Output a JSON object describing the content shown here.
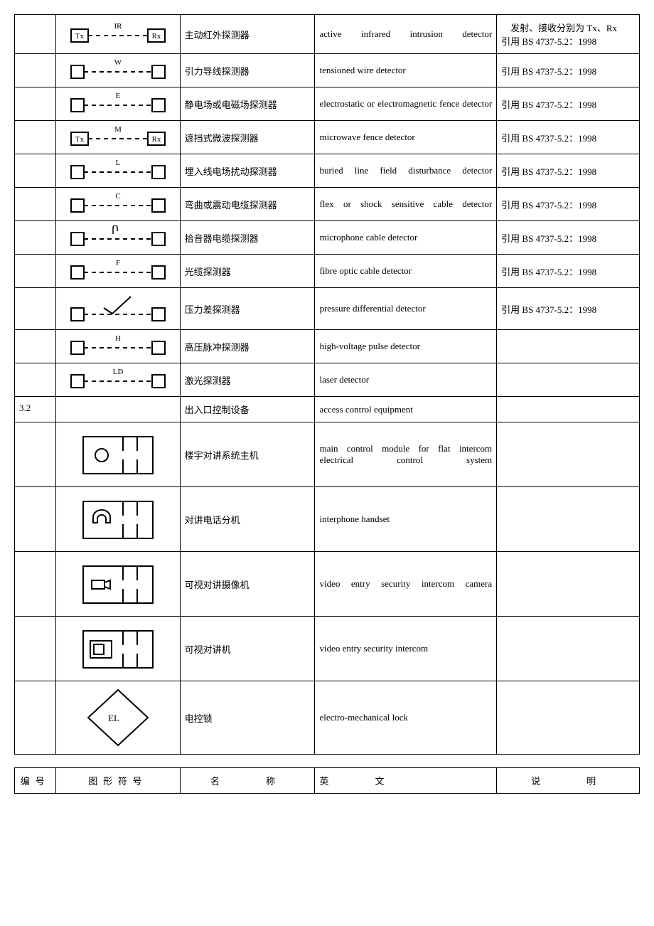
{
  "rows": [
    {
      "num": "",
      "sym": "ir",
      "cn": "主动红外探测器",
      "en": "active infrared intrusion detector",
      "note": "　发射、接收分别为 Tx、Rx　引用 BS 4737-5.2：1998"
    },
    {
      "num": "",
      "sym": "w",
      "cn": "引力导线探测器",
      "en": "tensioned wire detector",
      "note": "引用 BS 4737-5.2：1998"
    },
    {
      "num": "",
      "sym": "e",
      "cn": "静电场或电磁场探测器",
      "en": "electrostatic or electromagnetic fence detector",
      "note": "引用 BS 4737-5.2：1998"
    },
    {
      "num": "",
      "sym": "m",
      "cn": "遮挡式微波探测器",
      "en": "microwave fence detector",
      "note": "引用 BS 4737-5.2：1998"
    },
    {
      "num": "",
      "sym": "l",
      "cn": "埋入线电场扰动探测器",
      "en": "buried line field disturbance detector",
      "note": "引用 BS 4737-5.2：1998"
    },
    {
      "num": "",
      "sym": "c",
      "cn": "弯曲或震动电缆探测器",
      "en": "flex or shock sensitive cable detector",
      "note": "引用 BS 4737-5.2：1998"
    },
    {
      "num": "",
      "sym": "mic",
      "cn": "拾音器电缆探测器",
      "en": "microphone cable detector",
      "note": "引用 BS 4737-5.2：1998"
    },
    {
      "num": "",
      "sym": "f",
      "cn": "光缆探测器",
      "en": "fibre optic cable detector",
      "note": "引用 BS 4737-5.2：1998"
    },
    {
      "num": "",
      "sym": "p",
      "cn": "压力差探测器",
      "en": "pressure differential detector",
      "note": "引用 BS 4737-5.2：1998"
    },
    {
      "num": "",
      "sym": "h",
      "cn": "高压脉冲探测器",
      "en": "high-voltage pulse detector",
      "note": ""
    },
    {
      "num": "",
      "sym": "ld",
      "cn": "激光探测器",
      "en": "laser detector",
      "note": ""
    },
    {
      "num": "3.2",
      "sym": "",
      "cn": "出入口控制设备",
      "en": "access control equipment",
      "note": ""
    },
    {
      "num": "",
      "sym": "main",
      "cn": "楼宇对讲系统主机",
      "en": "main control module for flat intercom electrical control system",
      "note": ""
    },
    {
      "num": "",
      "sym": "handset",
      "cn": "对讲电话分机",
      "en": "interphone handset",
      "note": ""
    },
    {
      "num": "",
      "sym": "cam",
      "cn": "可视对讲摄像机",
      "en": "video entry security intercom camera",
      "note": ""
    },
    {
      "num": "",
      "sym": "vid",
      "cn": "可视对讲机",
      "en": "video entry security intercom",
      "note": ""
    },
    {
      "num": "",
      "sym": "el",
      "cn": "电控锁",
      "en": "electro-mechanical lock",
      "note": ""
    }
  ],
  "header": {
    "num": "编号",
    "sym": "图形符号",
    "cn": "名　　称",
    "en": "英　　文",
    "note": "说　　明"
  },
  "labels": {
    "IR": "IR",
    "W": "W",
    "E": "E",
    "M": "M",
    "L": "L",
    "C": "C",
    "F": "F",
    "H": "H",
    "LD": "LD",
    "Tx": "Tx",
    "Rx": "Rx",
    "EL": "EL"
  }
}
